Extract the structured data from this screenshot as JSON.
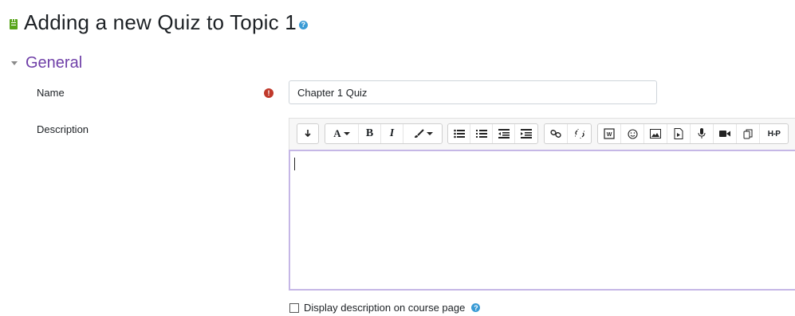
{
  "page": {
    "title": "Adding a new Quiz to Topic 1",
    "title_help_glyph": "?"
  },
  "section": {
    "title": "General"
  },
  "form": {
    "name_label": "Name",
    "name_value": "Chapter 1 Quiz",
    "required_glyph": "!",
    "description_label": "Description",
    "display_description_label": "Display description on course page",
    "display_description_checked": false,
    "help_glyph": "?"
  },
  "toolbar": {
    "font_label": "A",
    "bold_label": "B",
    "italic_label": "I",
    "h5p_label": "H-P"
  },
  "colors": {
    "section_accent": "#6f3fa8",
    "quiz_icon": "#58a41a",
    "required": "#c0392b",
    "help": "#3a9bd5",
    "editor_focus_border": "#c5b7e6"
  },
  "icons": [
    "quiz-icon",
    "help-icon",
    "collapse-caret-icon",
    "required-icon",
    "toggle-toolbar-icon",
    "font-icon",
    "bold-icon",
    "italic-icon",
    "brush-icon",
    "unordered-list-icon",
    "ordered-list-icon",
    "outdent-icon",
    "indent-icon",
    "link-icon",
    "unlink-icon",
    "word-import-icon",
    "emoji-icon",
    "image-icon",
    "media-icon",
    "microphone-icon",
    "video-icon",
    "copy-icon",
    "h5p-icon"
  ]
}
